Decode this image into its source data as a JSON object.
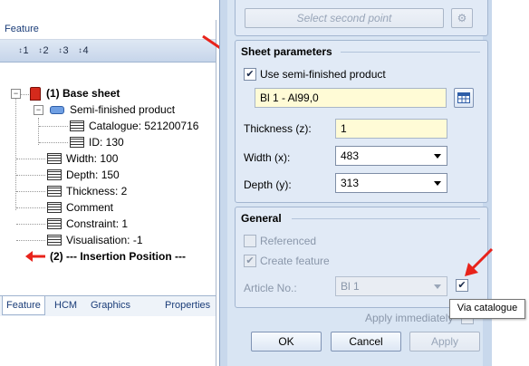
{
  "feature_panel": {
    "title": "Feature",
    "toolbar": [
      "1",
      "2",
      "3",
      "4"
    ],
    "tree": {
      "base_sheet": "(1) Base sheet",
      "semi_finished": "Semi-finished product",
      "catalogue": "Catalogue: 521200716",
      "id": "ID: 130",
      "width": "Width: 100",
      "depth": "Depth: 150",
      "thickness": "Thickness: 2",
      "comment": "Comment",
      "constraint": "Constraint: 1",
      "visualisation": "Visualisation: -1",
      "insertion": "(2) --- Insertion Position ---"
    },
    "tabs": [
      "Feature",
      "HCM",
      "Graphics",
      "Properties"
    ]
  },
  "dialog": {
    "select_second_point": "Select second point",
    "sheet_parameters": {
      "title": "Sheet parameters",
      "use_semi_finished": "Use semi-finished product",
      "use_semi_finished_checked": true,
      "material": "Bl 1 - Al99,0",
      "thickness_label": "Thickness (z):",
      "thickness_value": "1",
      "width_label": "Width (x):",
      "width_value": "483",
      "depth_label": "Depth (y):",
      "depth_value": "313"
    },
    "general": {
      "title": "General",
      "referenced": "Referenced",
      "create_feature": "Create feature",
      "article_label": "Article No.:",
      "article_value": "Bl 1",
      "via_catalogue_checked": true
    },
    "apply_immediately": "Apply immediately",
    "buttons": {
      "ok": "OK",
      "cancel": "Cancel",
      "apply": "Apply"
    },
    "tooltip": "Via catalogue"
  },
  "colors": {
    "annotation_arrow": "#e8231b",
    "dialog_bg": "#d9e5f3"
  }
}
